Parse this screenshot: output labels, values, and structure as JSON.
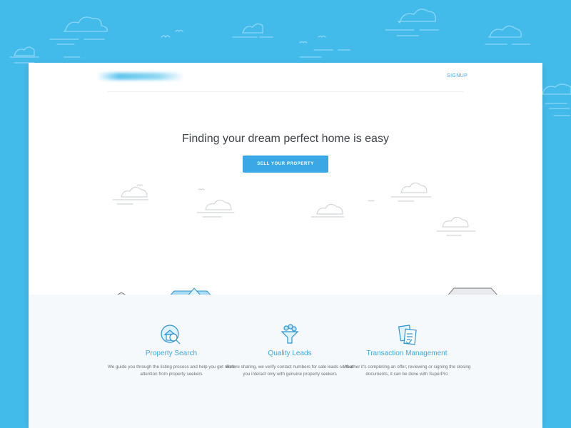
{
  "header": {
    "signup_label": "SIGNUP"
  },
  "hero": {
    "title": "Finding your dream perfect home is easy",
    "cta_label": "SELL YOUR PROPERTY"
  },
  "features": [
    {
      "title": "Property Search",
      "icon": "house-magnifier-icon",
      "description": "We guide you through the listing process and help you get more attention from property seekers"
    },
    {
      "title": "Quality Leads",
      "icon": "funnel-icon",
      "description": "Before sharing, we verify contact numbers for sale leads so that you interact only with genuine property seekers"
    },
    {
      "title": "Transaction Management",
      "icon": "documents-icon",
      "description": "Weather it's completing an offer, reviewing or signing the closing documents, it can be done with SuperPro"
    }
  ],
  "colors": {
    "background": "#43bbea",
    "accent": "#3aa8e4",
    "text": "#3c4248"
  }
}
